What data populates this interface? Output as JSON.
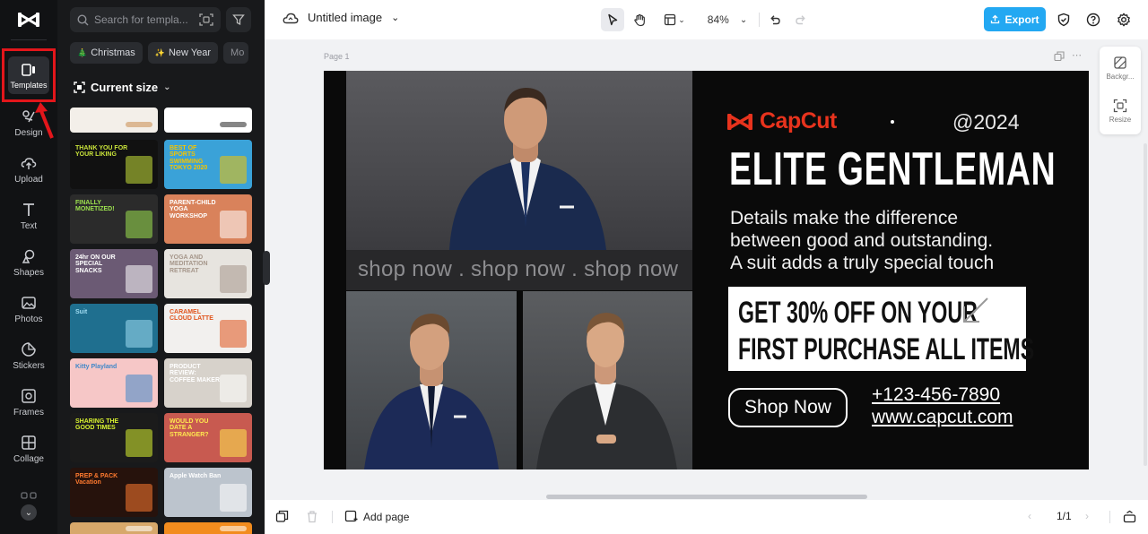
{
  "rail": {
    "items": [
      {
        "label": "Templates",
        "icon": "templates-icon"
      },
      {
        "label": "Design",
        "icon": "design-icon"
      },
      {
        "label": "Upload",
        "icon": "upload-icon"
      },
      {
        "label": "Text",
        "icon": "text-icon"
      },
      {
        "label": "Shapes",
        "icon": "shapes-icon"
      },
      {
        "label": "Photos",
        "icon": "photos-icon"
      },
      {
        "label": "Stickers",
        "icon": "stickers-icon"
      },
      {
        "label": "Frames",
        "icon": "frames-icon"
      },
      {
        "label": "Collage",
        "icon": "collage-icon"
      }
    ]
  },
  "panel": {
    "search_placeholder": "Search for templa...",
    "chips": [
      {
        "label": "Christmas",
        "icon": "🎄"
      },
      {
        "label": "New Year",
        "icon": "✨"
      },
      {
        "label": "Mo",
        "icon": ""
      }
    ],
    "size_label": "Current size",
    "thumbs": [
      {
        "text": "",
        "bg": "#f3efe9",
        "accent": "#c98b4d"
      },
      {
        "text": "",
        "bg": "#ffffff",
        "accent": "#222222"
      },
      {
        "text": "THANK YOU FOR YOUR LIKING",
        "bg": "#111111",
        "accent": "#c8e23a"
      },
      {
        "text": "BEST OF SPORTS SWIMMING TOKYO 2020",
        "bg": "#3aa2d8",
        "accent": "#f4c400"
      },
      {
        "text": "FINALLY MONETIZED!",
        "bg": "#2b2b2b",
        "accent": "#9de24f"
      },
      {
        "text": "PARENT-CHILD YOGA WORKSHOP",
        "bg": "#d9825b",
        "accent": "#ffffff"
      },
      {
        "text": "24hr ON OUR SPECIAL SNACKS",
        "bg": "#6b5a74",
        "accent": "#ffffff"
      },
      {
        "text": "YOGA AND MEDITATION RETREAT",
        "bg": "#e7e4df",
        "accent": "#a5968a"
      },
      {
        "text": "Suit",
        "bg": "#1f6f8f",
        "accent": "#9fdcf2"
      },
      {
        "text": "CARAMEL CLOUD LATTE",
        "bg": "#f2f0ee",
        "accent": "#e0541c"
      },
      {
        "text": "Kitty Playland",
        "bg": "#f6c7c7",
        "accent": "#3f87c8"
      },
      {
        "text": "PRODUCT REVIEW: COFFEE MAKER",
        "bg": "#d7d2cb",
        "accent": "#ffffff"
      },
      {
        "text": "SHARING THE GOOD TIMES",
        "bg": "#1b1b1b",
        "accent": "#d8f230"
      },
      {
        "text": "WOULD YOU DATE A STRANGER?",
        "bg": "#c85a50",
        "accent": "#ffe94f"
      },
      {
        "text": "PREP & PACK Vacation",
        "bg": "#26120c",
        "accent": "#ff7a2f"
      },
      {
        "text": "Apple Watch Ban",
        "bg": "#bcc4cd",
        "accent": "#ffffff"
      },
      {
        "text": "",
        "bg": "#d7a86b",
        "accent": "#ffffff"
      },
      {
        "text": "",
        "bg": "#f28c1e",
        "accent": "#ffffff"
      }
    ]
  },
  "topbar": {
    "title": "Untitled image",
    "zoom": "84%",
    "export_label": "Export"
  },
  "canvas": {
    "page_label": "Page 1",
    "brand": "CapCut",
    "year": "@2024",
    "headline": "ELITE GENTLEMAN",
    "body_lines": [
      "Details make the difference",
      "between good and outstanding.",
      "A suit adds a truly special touch"
    ],
    "offer_lines": [
      "GET 30% OFF ON YOUR",
      "FIRST PURCHASE ALL ITEMS"
    ],
    "cta": "Shop Now",
    "phone": "+123-456-7890",
    "website": "www.capcut.com",
    "marquee": "shop now . shop now . shop now"
  },
  "right_tools": [
    {
      "label": "Backgr...",
      "icon": "background-icon"
    },
    {
      "label": "Resize",
      "icon": "resize-icon"
    }
  ],
  "bottombar": {
    "add_page": "Add page",
    "pages": "1/1"
  },
  "colors": {
    "accent": "#23a8f2",
    "brand_red": "#e8331d",
    "highlight": "#e3161b"
  }
}
